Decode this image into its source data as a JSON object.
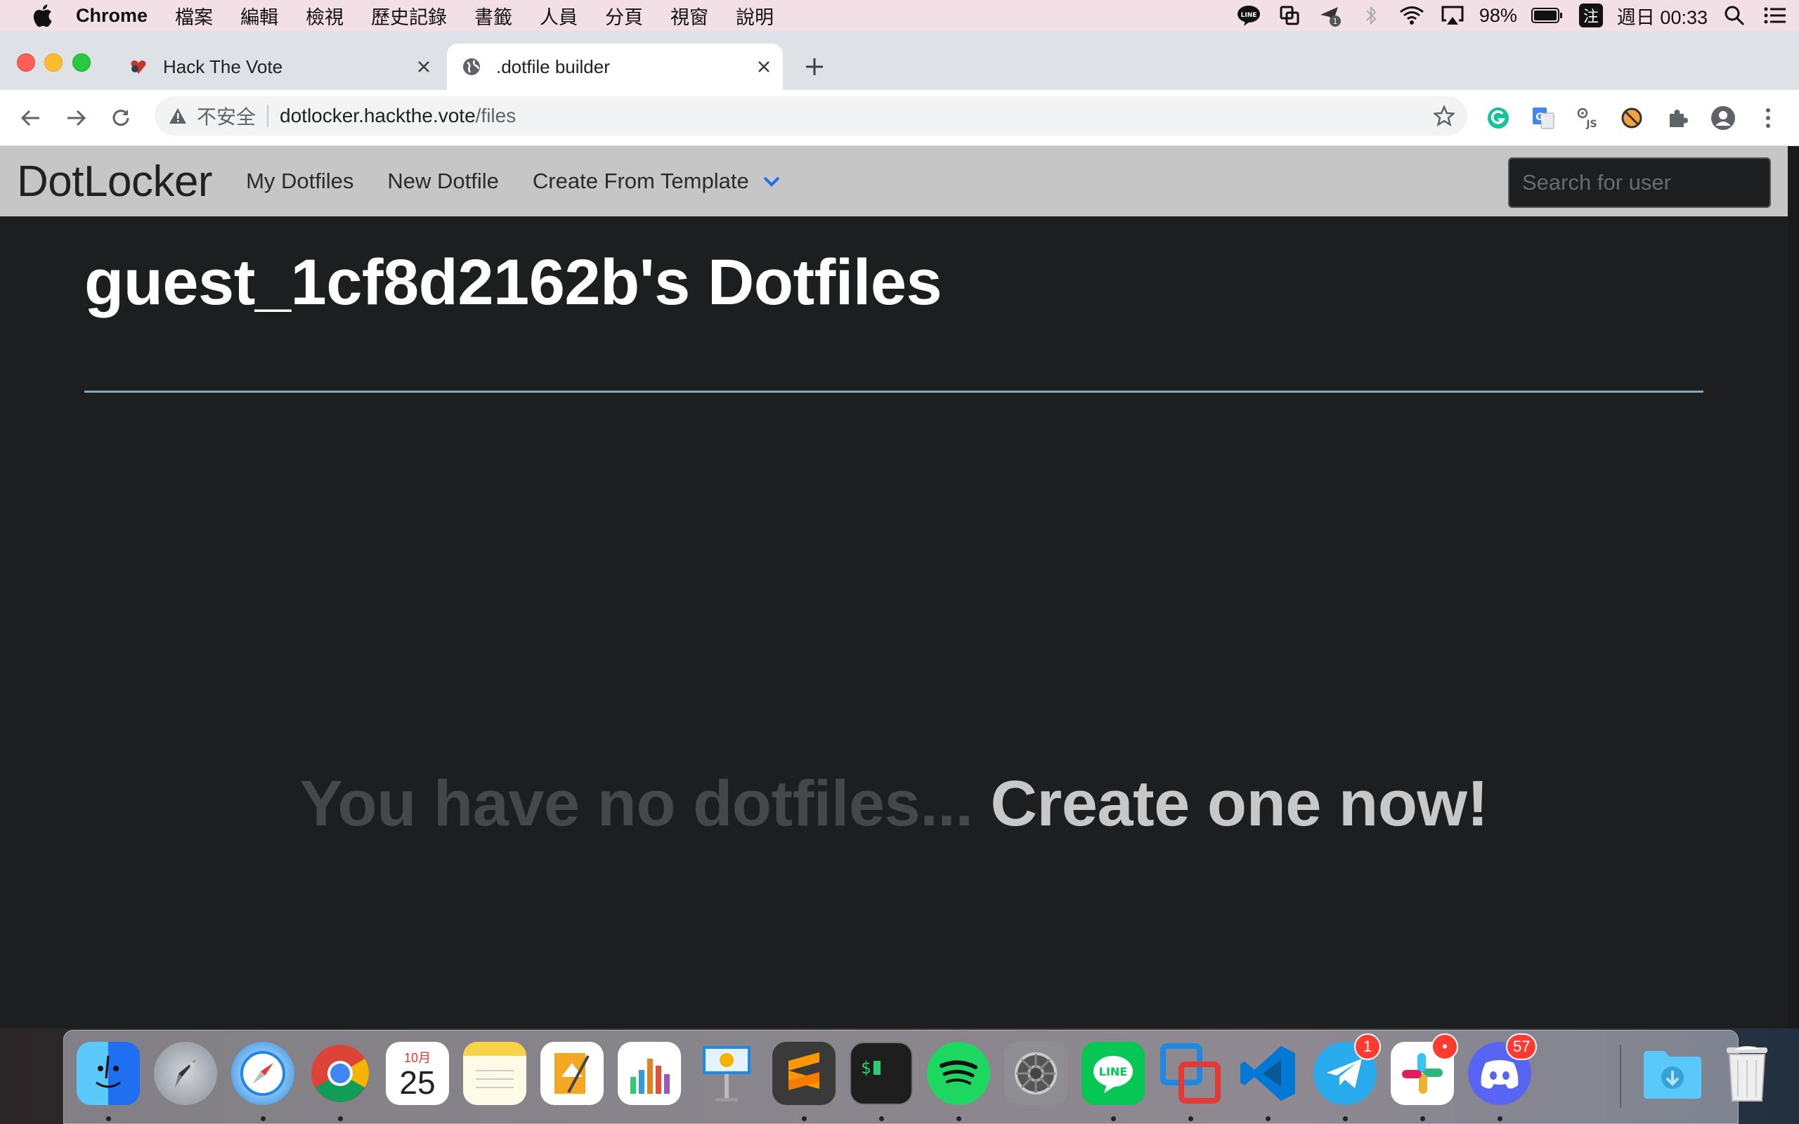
{
  "menubar": {
    "app_name": "Chrome",
    "items": [
      "檔案",
      "編輯",
      "檢視",
      "歷史記錄",
      "書籤",
      "人員",
      "分頁",
      "視窗",
      "說明"
    ],
    "battery": "98%",
    "input_method": "注",
    "clock": "週日 00:33"
  },
  "tabs": [
    {
      "title": "Hack The Vote",
      "active": false
    },
    {
      "title": ".dotfile builder",
      "active": true
    }
  ],
  "omnibox": {
    "security_label": "不安全",
    "url_host": "dotlocker.hackthe.vote",
    "url_path": "/files"
  },
  "site": {
    "brand": "DotLocker",
    "nav": {
      "my_dotfiles": "My Dotfiles",
      "new_dotfile": "New Dotfile",
      "create_from_template": "Create From Template"
    },
    "search_placeholder": "Search for user"
  },
  "main": {
    "heading": "guest_1cf8d2162b's Dotfiles",
    "empty_text": "You have no dotfiles...",
    "empty_cta": "Create one now!"
  },
  "dock": {
    "calendar_month": "10月",
    "calendar_day": "25",
    "badges": {
      "telegram": "1",
      "slack": "•",
      "discord": "57"
    }
  },
  "colors": {
    "page_bg": "#1d1e20",
    "navbar_bg": "#c6c6c6",
    "rule": "#8aa4b8",
    "caret_accent": "#1a73e8"
  }
}
